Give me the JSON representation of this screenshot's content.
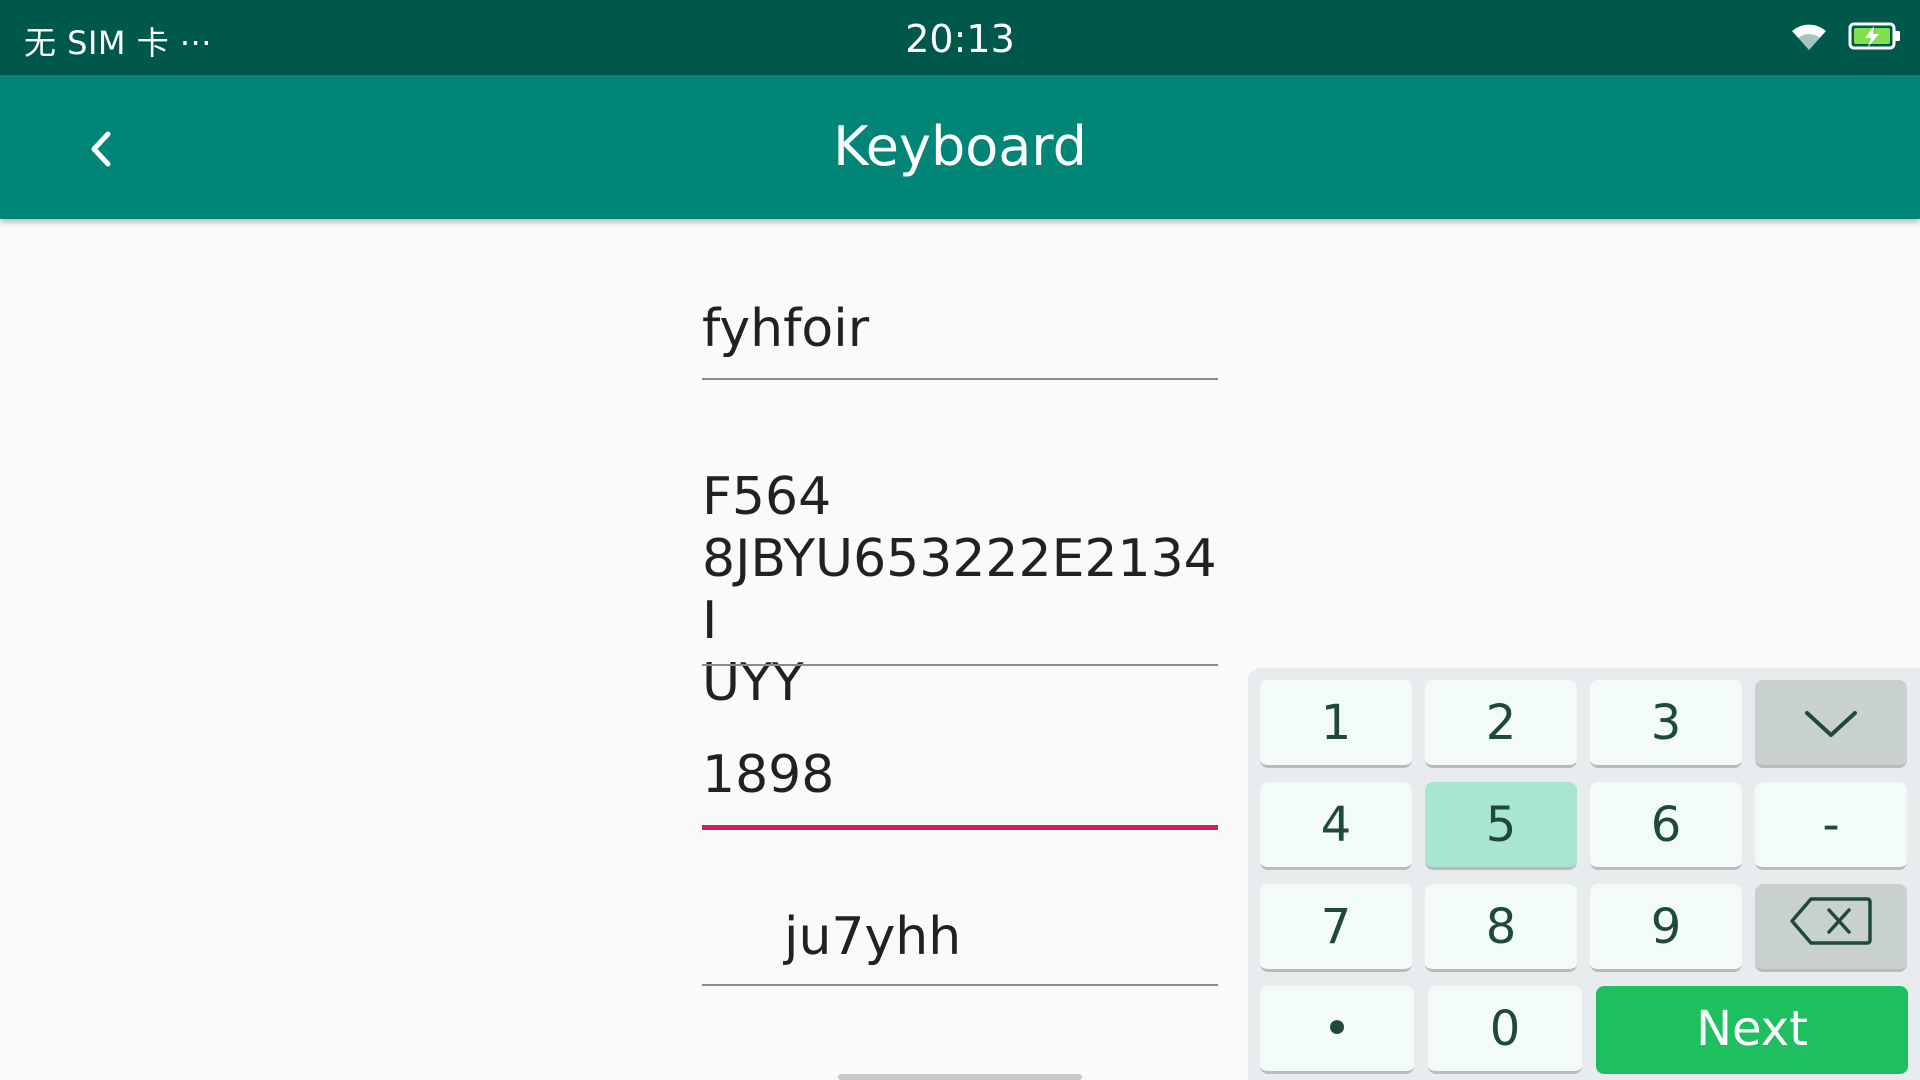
{
  "status_bar": {
    "carrier": "无 SIM 卡 ···",
    "time": "20:13",
    "icons": [
      "wifi-icon",
      "battery-charging-icon"
    ]
  },
  "app_bar": {
    "title": "Keyboard",
    "back_icon": "chevron-left-icon"
  },
  "fields": [
    {
      "value": "fyhfoir",
      "focused": false
    },
    {
      "value": "F564\n8JBYU653222E2134I\nUYY",
      "focused": false
    },
    {
      "value": "1898",
      "focused": true
    },
    {
      "value": "ju7yhh",
      "focused": false
    }
  ],
  "keyboard": {
    "row1": [
      "1",
      "2",
      "3"
    ],
    "row2": [
      "4",
      "5",
      "6",
      "-"
    ],
    "row3": [
      "7",
      "8",
      "9"
    ],
    "dot": "•",
    "zero": "0",
    "next": "Next",
    "hide_icon": "chevron-down-icon",
    "backspace_icon": "backspace-icon",
    "pressed_key": "5"
  },
  "colors": {
    "status_bar": "#00574b",
    "app_bar": "#008577",
    "focus_underline": "#d81b60",
    "next_key": "#1dbf5e",
    "pressed_key": "#a8e6d0"
  }
}
